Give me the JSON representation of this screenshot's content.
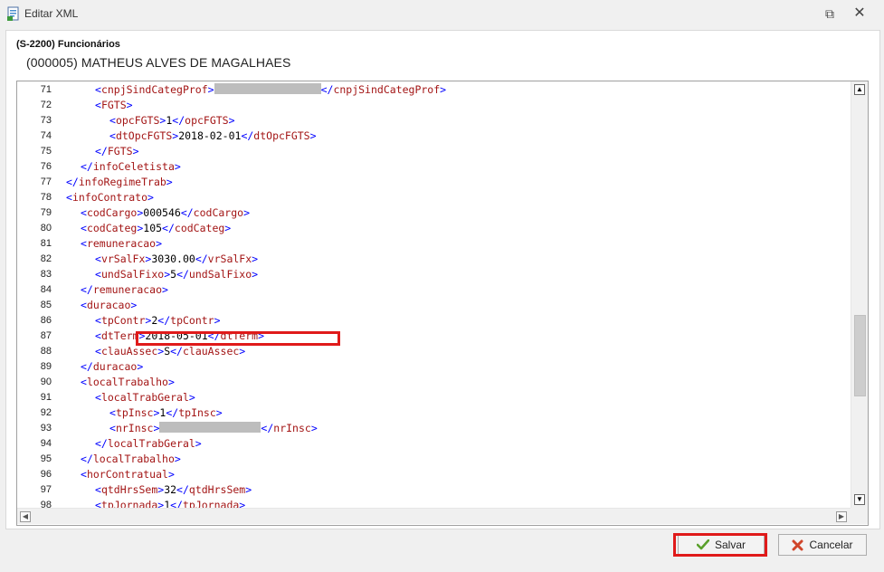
{
  "window": {
    "title": "Editar XML",
    "restore_glyph": "⧉",
    "close_glyph": "✕"
  },
  "header": {
    "entity": "(S-2200) Funcionários",
    "employee": "(000005) MATHEUS ALVES DE MAGALHAES"
  },
  "editor": {
    "lines": [
      {
        "n": "71",
        "indent": 6,
        "kind": "redacted",
        "tag": "cnpjSindCategProf",
        "redact_w": 118
      },
      {
        "n": "72",
        "indent": 6,
        "kind": "open",
        "tag": "FGTS"
      },
      {
        "n": "73",
        "indent": 7,
        "kind": "elem",
        "tag": "opcFGTS",
        "value": "1"
      },
      {
        "n": "74",
        "indent": 7,
        "kind": "elem",
        "tag": "dtOpcFGTS",
        "value": "2018-02-01"
      },
      {
        "n": "75",
        "indent": 6,
        "kind": "close",
        "tag": "FGTS"
      },
      {
        "n": "76",
        "indent": 5,
        "kind": "close",
        "tag": "infoCeletista"
      },
      {
        "n": "77",
        "indent": 4,
        "kind": "close",
        "tag": "infoRegimeTrab"
      },
      {
        "n": "78",
        "indent": 4,
        "kind": "open",
        "tag": "infoContrato"
      },
      {
        "n": "79",
        "indent": 5,
        "kind": "elem",
        "tag": "codCargo",
        "value": "000546"
      },
      {
        "n": "80",
        "indent": 5,
        "kind": "elem",
        "tag": "codCateg",
        "value": "105"
      },
      {
        "n": "81",
        "indent": 5,
        "kind": "open",
        "tag": "remuneracao"
      },
      {
        "n": "82",
        "indent": 6,
        "kind": "elem",
        "tag": "vrSalFx",
        "value": "3030.00"
      },
      {
        "n": "83",
        "indent": 6,
        "kind": "elem",
        "tag": "undSalFixo",
        "value": "5"
      },
      {
        "n": "84",
        "indent": 5,
        "kind": "close",
        "tag": "remuneracao"
      },
      {
        "n": "85",
        "indent": 5,
        "kind": "open",
        "tag": "duracao"
      },
      {
        "n": "86",
        "indent": 6,
        "kind": "elem",
        "tag": "tpContr",
        "value": "2"
      },
      {
        "n": "87",
        "indent": 6,
        "kind": "elem",
        "tag": "dtTerm",
        "value": "2018-05-01"
      },
      {
        "n": "88",
        "indent": 6,
        "kind": "elem",
        "tag": "clauAssec",
        "value": "S"
      },
      {
        "n": "89",
        "indent": 5,
        "kind": "close",
        "tag": "duracao"
      },
      {
        "n": "90",
        "indent": 5,
        "kind": "open",
        "tag": "localTrabalho"
      },
      {
        "n": "91",
        "indent": 6,
        "kind": "open",
        "tag": "localTrabGeral"
      },
      {
        "n": "92",
        "indent": 7,
        "kind": "elem",
        "tag": "tpInsc",
        "value": "1"
      },
      {
        "n": "93",
        "indent": 7,
        "kind": "redacted",
        "tag": "nrInsc",
        "redact_w": 112
      },
      {
        "n": "94",
        "indent": 6,
        "kind": "close",
        "tag": "localTrabGeral"
      },
      {
        "n": "95",
        "indent": 5,
        "kind": "close",
        "tag": "localTrabalho"
      },
      {
        "n": "96",
        "indent": 5,
        "kind": "open",
        "tag": "horContratual"
      },
      {
        "n": "97",
        "indent": 6,
        "kind": "elem",
        "tag": "qtdHrsSem",
        "value": "32"
      },
      {
        "n": "98",
        "indent": 6,
        "kind": "elem",
        "tag": "tpJornada",
        "value": "1"
      }
    ]
  },
  "scrollbar": {
    "up_glyph": "▲",
    "down_glyph": "▼",
    "left_glyph": "◀",
    "right_glyph": "▶"
  },
  "buttons": {
    "save_label": "Salvar",
    "cancel_label": "Cancelar"
  },
  "colors": {
    "bracket": "#0000ff",
    "tag": "#a31515",
    "highlight": "#e01a1a"
  }
}
